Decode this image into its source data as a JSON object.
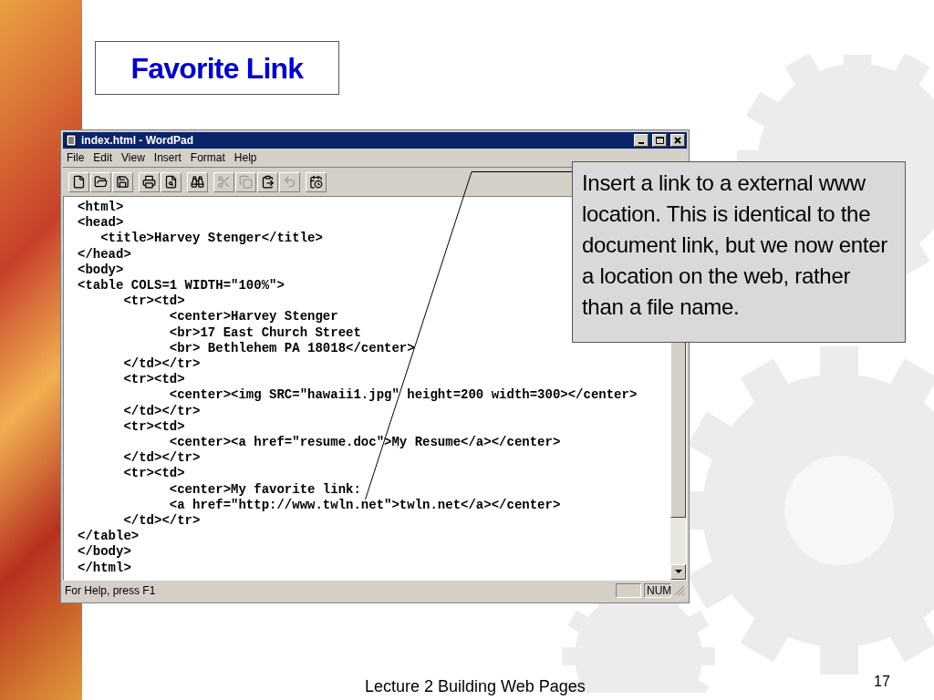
{
  "slide": {
    "title": "Favorite Link",
    "footer": "Lecture 2 Building Web Pages",
    "page_number": "17"
  },
  "window": {
    "title": "index.html - WordPad",
    "menu": [
      "File",
      "Edit",
      "View",
      "Insert",
      "Format",
      "Help"
    ],
    "toolbar": [
      [
        {
          "kind": "new",
          "disabled": false
        },
        {
          "kind": "open",
          "disabled": false
        },
        {
          "kind": "save",
          "disabled": false
        }
      ],
      [
        {
          "kind": "print",
          "disabled": false
        },
        {
          "kind": "preview",
          "disabled": false
        }
      ],
      [
        {
          "kind": "find",
          "disabled": false
        }
      ],
      [
        {
          "kind": "cut",
          "disabled": true
        },
        {
          "kind": "copy",
          "disabled": true
        },
        {
          "kind": "paste",
          "disabled": false
        },
        {
          "kind": "undo",
          "disabled": true
        }
      ],
      [
        {
          "kind": "datetime",
          "disabled": false
        }
      ]
    ],
    "lines": [
      "<html>",
      "<head>",
      "   <title>Harvey Stenger</title>",
      "</head>",
      "<body>",
      "<table COLS=1 WIDTH=\"100%\">",
      "      <tr><td>",
      "            <center>Harvey Stenger",
      "            <br>17 East Church Street",
      "            <br> Bethlehem PA 18018</center>",
      "      </td></tr>",
      "      <tr><td>",
      "            <center><img SRC=\"hawaii1.jpg\" height=200 width=300></center>",
      "      </td></tr>",
      "      <tr><td>",
      "            <center><a href=\"resume.doc\">My Resume</a></center>",
      "      </td></tr>",
      "      <tr><td>",
      "            <center>My favorite link:",
      "            <a href=\"http://www.twln.net\">twln.net</a></center>",
      "      </td></tr>",
      "</table>",
      "</body>",
      "</html>"
    ],
    "status_bar": {
      "help": "For Help, press F1",
      "indicator": "NUM"
    }
  },
  "callout": {
    "text": "Insert a link to a external www location. This is identical to the document link, but we now enter a location on the web, rather than a file name."
  }
}
